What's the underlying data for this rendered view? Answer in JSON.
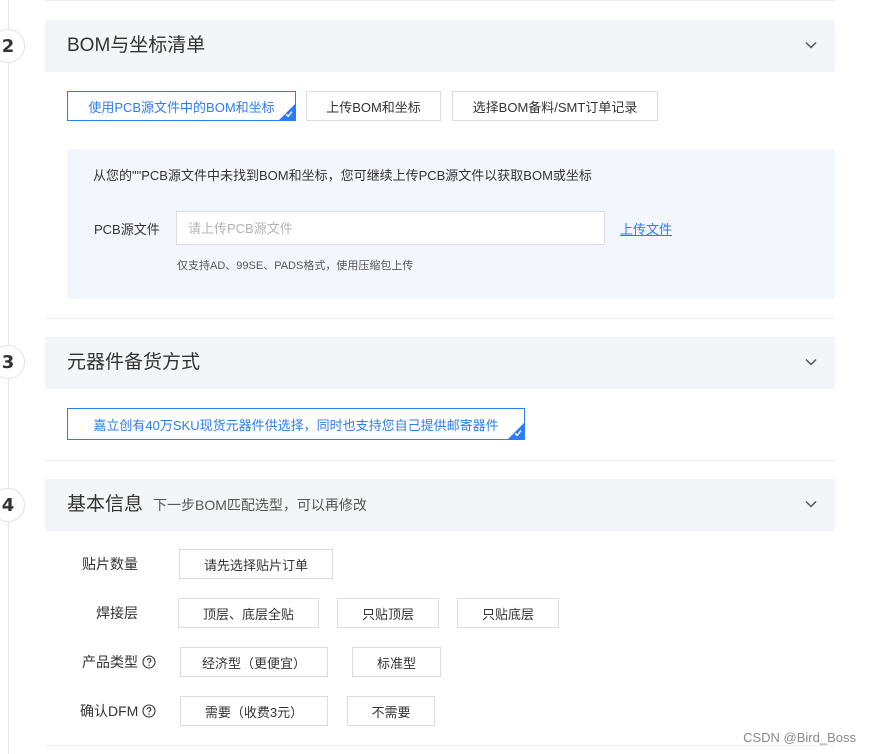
{
  "steps": {
    "bom": {
      "number": "2",
      "title": "BOM与坐标清单",
      "options": [
        {
          "label": "使用PCB源文件中的BOM和坐标",
          "selected": true
        },
        {
          "label": "上传BOM和坐标",
          "selected": false
        },
        {
          "label": "选择BOM备料/SMT订单记录",
          "selected": false
        }
      ],
      "panel": {
        "hint": "从您的\"\"PCB源文件中未找到BOM和坐标，您可继续上传PCB源文件以获取BOM或坐标",
        "file_label": "PCB源文件",
        "file_placeholder": "请上传PCB源文件",
        "upload_link": "上传文件",
        "note": "仅支持AD、99SE、PADS格式，使用压缩包上传"
      }
    },
    "components": {
      "number": "3",
      "title": "元器件备货方式",
      "options": [
        {
          "label": "嘉立创有40万SKU现货元器件供选择，同时也支持您自己提供邮寄器件",
          "selected": true
        }
      ]
    },
    "basic": {
      "number": "4",
      "title": "基本信息",
      "subtitle": "下一步BOM匹配选型，可以再修改",
      "rows": {
        "quantity": {
          "label": "贴片数量",
          "options": [
            "请先选择贴片订单"
          ]
        },
        "layer": {
          "label": "焊接层",
          "options": [
            "顶层、底层全贴",
            "只贴顶层",
            "只贴底层"
          ]
        },
        "product_type": {
          "label": "产品类型",
          "options": [
            "经济型（更便宜）",
            "标准型"
          ]
        },
        "dfm": {
          "label": "确认DFM",
          "options": [
            "需要（收费3元）",
            "不需要"
          ]
        }
      }
    }
  },
  "icons": {
    "chevron": "chevron-down-icon",
    "help": "question-circle-icon",
    "check": "check-icon"
  },
  "colors": {
    "accent": "#2d7cf6",
    "header_bg": "#f4f5f8",
    "panel_bg": "#f3f7fd"
  },
  "watermark": "CSDN @Bird_Boss"
}
